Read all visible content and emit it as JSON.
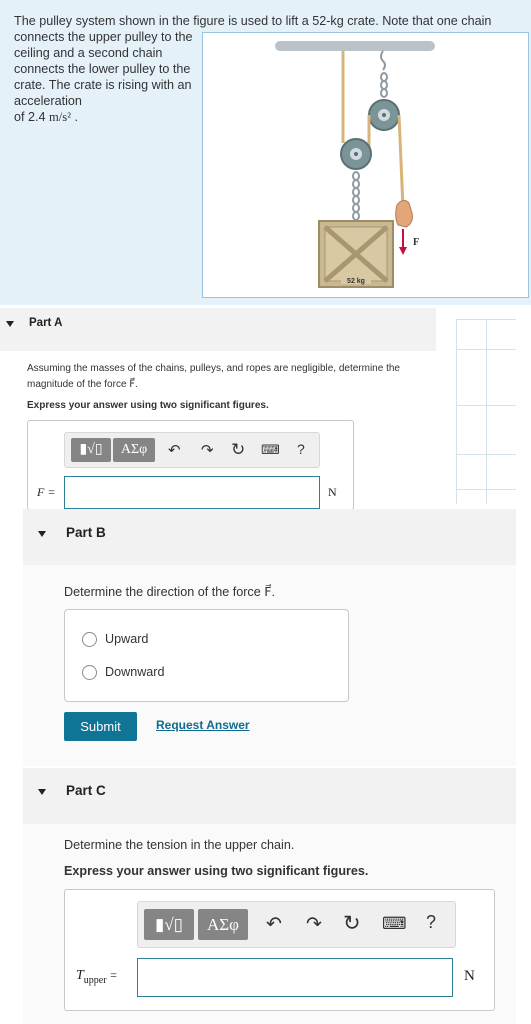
{
  "problem": {
    "line1": "The pulley system shown in the figure is used to lift a 52-kg crate. Note that one chain",
    "rest": "connects the upper pulley to the ceiling and a second chain connects the lower pulley to the crate. The crate is rising with an acceleration",
    "accel_prefix": "of 2.4 ",
    "accel_unit": "m/s²",
    "accel_suffix": " ."
  },
  "figure": {
    "crate_label": "52 kg",
    "force_label": "F"
  },
  "partA": {
    "label": "Part A",
    "question": "Assuming the masses of the chains, pulleys, and ropes are negligible, determine the magnitude of the force F⃗.",
    "hint": "Express your answer using two significant figures.",
    "var_label": "F =",
    "unit": "N",
    "value": "",
    "toolbar": {
      "templates": "▮√▯",
      "symbols": "ΑΣφ",
      "help": "?"
    }
  },
  "partB": {
    "label": "Part B",
    "question": "Determine the direction of the force F⃗.",
    "options": [
      "Upward",
      "Downward"
    ],
    "submit": "Submit",
    "request": "Request Answer"
  },
  "partC": {
    "label": "Part C",
    "question": "Determine the tension in the upper chain.",
    "hint": "Express your answer using two significant figures.",
    "var_main": "T",
    "var_sub": "upper",
    "var_eq": "=",
    "unit": "N",
    "value": "",
    "toolbar": {
      "templates": "▮√▯",
      "symbols": "ΑΣφ",
      "help": "?"
    }
  },
  "colors": {
    "accent": "#0f7496",
    "problem_bg": "#e5f1f9",
    "field_border": "#2f7d96",
    "force_arrow": "#c4123a"
  }
}
